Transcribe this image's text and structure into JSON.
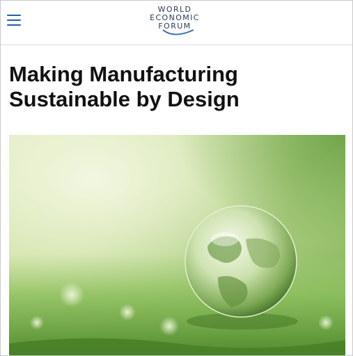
{
  "header": {
    "menu_icon": "hamburger-menu-icon",
    "logo_lines": [
      "WORLD",
      "ECONOMIC",
      "FORUM"
    ],
    "logo_color": "#2b3a55",
    "menu_color": "#1f5fa8"
  },
  "article": {
    "title": "Making Manufacturing Sustainable by Design",
    "hero_image": "glass-globe-on-grass"
  }
}
